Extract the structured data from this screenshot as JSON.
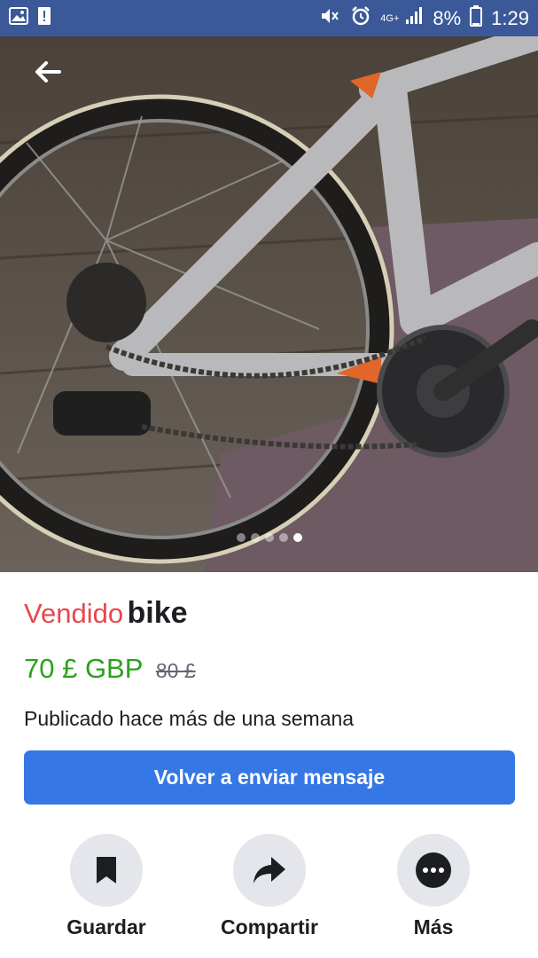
{
  "status_bar": {
    "network": "4G+",
    "battery": "8%",
    "time": "1:29",
    "icons": [
      "image-icon",
      "notification-icon",
      "mute-icon",
      "alarm-icon",
      "signal-icon",
      "battery-icon"
    ]
  },
  "hero": {
    "dot_count": 5,
    "active_dot": 5
  },
  "listing": {
    "status": "Vendido",
    "title": "bike",
    "price": "70 £ GBP",
    "old_price": "80 £",
    "posted": "Publicado hace más de una semana"
  },
  "primary_button": {
    "label": "Volver a enviar mensaje",
    "color": "#3578e5"
  },
  "actions": [
    {
      "label": "Guardar",
      "icon": "bookmark-icon"
    },
    {
      "label": "Compartir",
      "icon": "share-arrow-icon"
    },
    {
      "label": "Más",
      "icon": "more-dots-icon"
    }
  ],
  "colors": {
    "status_bar": "#3b5998",
    "sold": "#e7474b",
    "price": "#2aa21a",
    "action_bg": "#e4e6eb"
  }
}
